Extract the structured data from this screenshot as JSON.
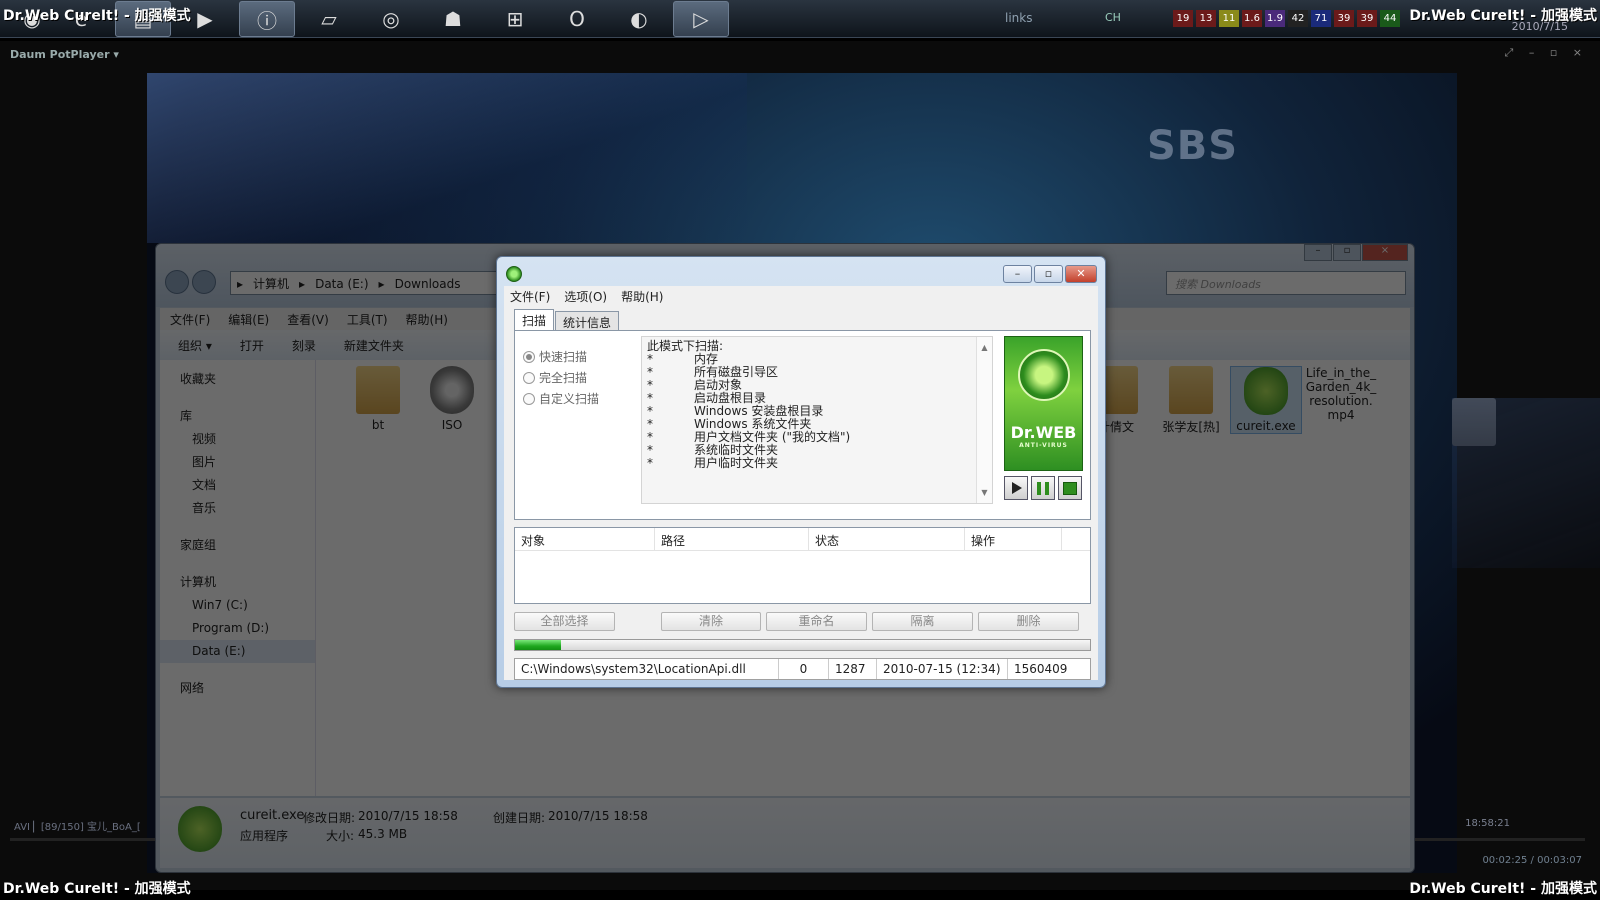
{
  "watermark": "Dr.Web CureIt! - 加强模式",
  "taskbar": {
    "links_label": "links",
    "lang": "CH",
    "meters": [
      "19",
      "13",
      "11",
      "1.6",
      "1.9",
      "42",
      "71",
      "39",
      "39",
      "44"
    ],
    "meter_colors": [
      "#6b1a1a",
      "#6b1a1a",
      "#8a8a1a",
      "#6b1a1a",
      "#4a2a7a",
      "#222",
      "#1a2a7a",
      "#6b1a1a",
      "#6b1a1a",
      "#1a5a1a"
    ],
    "date": "2010/7/15",
    "buttons": [
      "windows-orb-icon",
      "ie-icon",
      "explorer-icon",
      "media-icon",
      "info-icon",
      "book-icon",
      "eye-icon",
      "alien-icon",
      "windows-icon",
      "opera-icon",
      "firefox-icon",
      "potplayer-icon"
    ]
  },
  "potplayer": {
    "title": "Daum PotPlayer",
    "bottom_left": "AVI ▏[89/150] 宝儿_BoA_[",
    "bottom_right": "18:58:21",
    "time": "00:02:25 / 00:03:07",
    "channel_logo": "SBS"
  },
  "explorer": {
    "breadcrumb": [
      "计算机",
      "Data (E:)",
      "Downloads"
    ],
    "search_placeholder": "搜索 Downloads",
    "menu": [
      "文件(F)",
      "编辑(E)",
      "查看(V)",
      "工具(T)",
      "帮助(H)"
    ],
    "toolbar": [
      "组织 ▾",
      "打开",
      "刻录",
      "新建文件夹"
    ],
    "sidebar": [
      {
        "label": "收藏夹",
        "level": "top"
      },
      {
        "label": "库",
        "level": "top"
      },
      {
        "label": "视频",
        "level": "sub"
      },
      {
        "label": "图片",
        "level": "sub"
      },
      {
        "label": "文档",
        "level": "sub"
      },
      {
        "label": "音乐",
        "level": "sub"
      },
      {
        "label": "家庭组",
        "level": "top"
      },
      {
        "label": "计算机",
        "level": "top"
      },
      {
        "label": "Win7 (C:)",
        "level": "sub"
      },
      {
        "label": "Program (D:)",
        "level": "sub"
      },
      {
        "label": "Data (E:)",
        "level": "sub"
      },
      {
        "label": "网络",
        "level": "top"
      }
    ],
    "files_left": [
      {
        "name": "bt",
        "kind": "folder"
      },
      {
        "name": "ISO",
        "kind": "disc"
      }
    ],
    "files_right": [
      {
        "name": "叶倩文",
        "kind": "folder"
      },
      {
        "name": "张学友[热]",
        "kind": "folder"
      },
      {
        "name": "cureit.exe",
        "kind": "drweb"
      },
      {
        "name": "Life_in_the_Garden_4k_resolution.mp4",
        "kind": "video"
      }
    ],
    "details": {
      "name": "cureit.exe",
      "modified_label": "修改日期:",
      "modified": "2010/7/15 18:58",
      "created_label": "创建日期:",
      "created": "2010/7/15 18:58",
      "type": "应用程序",
      "size_label": "大小:",
      "size": "45.3 MB"
    }
  },
  "drweb": {
    "menu": [
      "文件(F)",
      "选项(O)",
      "帮助(H)"
    ],
    "tabs": [
      "扫描",
      "统计信息"
    ],
    "radios": [
      {
        "label": "快速扫描",
        "checked": true
      },
      {
        "label": "完全扫描",
        "checked": false
      },
      {
        "label": "自定义扫描",
        "checked": false
      }
    ],
    "info_heading": "此模式下扫描:",
    "info_items": [
      "内存",
      "所有磁盘引导区",
      "启动对象",
      "启动盘根目录",
      "Windows 安装盘根目录",
      "Windows 系统文件夹",
      "用户文档文件夹 (\"我的文档\")",
      "系统临时文件夹",
      "用户临时文件夹"
    ],
    "logo": {
      "brand": "Dr.WEB",
      "sub": "ANTI-VIRUS"
    },
    "table_headers": [
      "对象",
      "路径",
      "状态",
      "操作"
    ],
    "buttons": [
      "全部选择",
      "清除",
      "重命名",
      "隔离",
      "删除"
    ],
    "progress": 0.08,
    "status": {
      "path": "C:\\Windows\\system32\\LocationApi.dll",
      "count_a": "0",
      "count_b": "1287",
      "datetime": "2010-07-15 (12:34)",
      "number": "1560409"
    }
  }
}
